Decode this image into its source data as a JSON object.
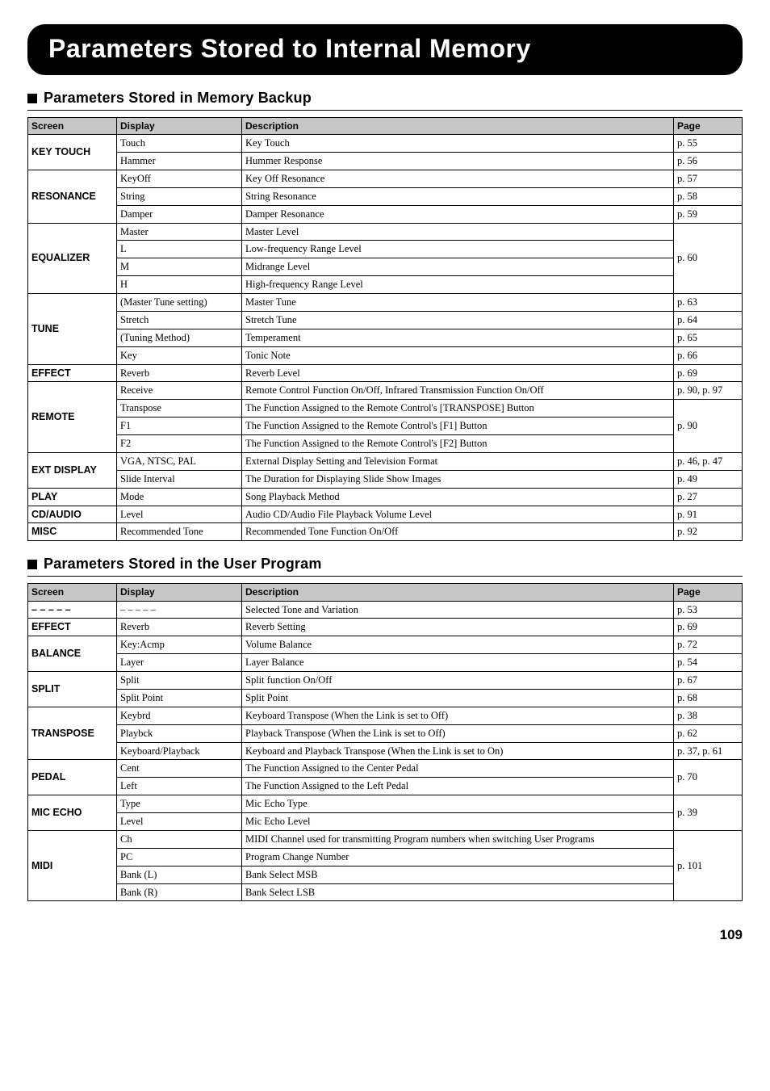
{
  "page_title": "Parameters Stored to Internal Memory",
  "page_number": "109",
  "sections": [
    {
      "title": "Parameters Stored in Memory Backup",
      "headers": {
        "screen": "Screen",
        "display": "Display",
        "description": "Description",
        "page": "Page"
      },
      "groups": [
        {
          "screen": "KEY TOUCH",
          "rows": [
            {
              "display": "Touch",
              "description": "Key Touch",
              "page": "p. 55"
            },
            {
              "display": "Hammer",
              "description": "Hummer Response",
              "page": "p. 56"
            }
          ]
        },
        {
          "screen": "RESONANCE",
          "rows": [
            {
              "display": "KeyOff",
              "description": "Key Off Resonance",
              "page": "p. 57"
            },
            {
              "display": "String",
              "description": "String Resonance",
              "page": "p. 58"
            },
            {
              "display": "Damper",
              "description": "Damper Resonance",
              "page": "p. 59"
            }
          ]
        },
        {
          "screen": "EQUALIZER",
          "page_shared": "p. 60",
          "rows": [
            {
              "display": "Master",
              "description": "Master Level"
            },
            {
              "display": "L",
              "description": "Low-frequency Range Level"
            },
            {
              "display": "M",
              "description": "Midrange Level"
            },
            {
              "display": "H",
              "description": "High-frequency Range Level"
            }
          ]
        },
        {
          "screen": "TUNE",
          "rows": [
            {
              "display": "(Master Tune setting)",
              "description": "Master Tune",
              "page": "p. 63"
            },
            {
              "display": "Stretch",
              "description": "Stretch Tune",
              "page": "p. 64"
            },
            {
              "display": "(Tuning Method)",
              "description": "Temperament",
              "page": "p. 65"
            },
            {
              "display": "Key",
              "description": "Tonic Note",
              "page": "p. 66"
            }
          ]
        },
        {
          "screen": "EFFECT",
          "rows": [
            {
              "display": "Reverb",
              "description": "Reverb Level",
              "page": "p. 69"
            }
          ]
        },
        {
          "screen": "REMOTE",
          "rows": [
            {
              "display": "Receive",
              "description": "Remote Control Function On/Off,\nInfrared Transmission Function On/Off",
              "page": "p. 90, p. 97"
            },
            {
              "display": "Transpose",
              "description": "The Function Assigned to the Remote Control's [TRANSPOSE] Button",
              "page_shared_start": true,
              "page_shared_value": "p. 90",
              "page_shared_span": 3
            },
            {
              "display": "F1",
              "description": "The Function Assigned to the Remote Control's [F1] Button"
            },
            {
              "display": "F2",
              "description": "The Function Assigned to the Remote Control's [F2] Button"
            }
          ]
        },
        {
          "screen": "EXT DISPLAY",
          "rows": [
            {
              "display": "VGA, NTSC, PAL",
              "description": "External Display Setting and Television Format",
              "page": "p. 46, p. 47"
            },
            {
              "display": "Slide Interval",
              "description": "The Duration for Displaying Slide Show Images",
              "page": "p. 49"
            }
          ]
        },
        {
          "screen": "PLAY",
          "rows": [
            {
              "display": "Mode",
              "description": "Song Playback Method",
              "page": "p. 27"
            }
          ]
        },
        {
          "screen": "CD/AUDIO",
          "rows": [
            {
              "display": "Level",
              "description": "Audio CD/Audio File Playback Volume Level",
              "page": "p. 91"
            }
          ]
        },
        {
          "screen": "MISC",
          "rows": [
            {
              "display": "Recommended Tone",
              "description": "Recommended Tone Function On/Off",
              "page": "p. 92"
            }
          ]
        }
      ]
    },
    {
      "title": "Parameters Stored in the User Program",
      "headers": {
        "screen": "Screen",
        "display": "Display",
        "description": "Description",
        "page": "Page"
      },
      "groups": [
        {
          "screen": "– – – – –",
          "rows": [
            {
              "display": "– – – – –",
              "description": "Selected Tone and Variation",
              "page": "p. 53"
            }
          ]
        },
        {
          "screen": "EFFECT",
          "rows": [
            {
              "display": "Reverb",
              "description": "Reverb Setting",
              "page": "p. 69"
            }
          ]
        },
        {
          "screen": "BALANCE",
          "rows": [
            {
              "display": "Key:Acmp",
              "description": "Volume Balance",
              "page": "p. 72"
            },
            {
              "display": "Layer",
              "description": "Layer Balance",
              "page": "p. 54"
            }
          ]
        },
        {
          "screen": "SPLIT",
          "rows": [
            {
              "display": "Split",
              "description": "Split function On/Off",
              "page": "p. 67"
            },
            {
              "display": "Split Point",
              "description": "Split Point",
              "page": "p. 68"
            }
          ]
        },
        {
          "screen": "TRANSPOSE",
          "rows": [
            {
              "display": "Keybrd",
              "description": "Keyboard Transpose (When the Link is set to Off)",
              "page": "p. 38"
            },
            {
              "display": "Playbck",
              "description": "Playback Transpose (When the Link is set to Off)",
              "page": "p. 62"
            },
            {
              "display": "Keyboard/Playback",
              "description": "Keyboard and Playback Transpose\n(When the Link is set to On)",
              "page": "p. 37, p. 61"
            }
          ]
        },
        {
          "screen": "PEDAL",
          "page_shared": "p. 70",
          "rows": [
            {
              "display": "Cent",
              "description": "The Function Assigned to the Center Pedal"
            },
            {
              "display": "Left",
              "description": "The Function Assigned to the Left Pedal"
            }
          ]
        },
        {
          "screen": "MIC ECHO",
          "page_shared": "p. 39",
          "rows": [
            {
              "display": "Type",
              "description": "Mic Echo Type"
            },
            {
              "display": "Level",
              "description": "Mic Echo Level"
            }
          ]
        },
        {
          "screen": "MIDI",
          "page_shared": "p. 101",
          "rows": [
            {
              "display": "Ch",
              "description": "MIDI Channel used for transmitting Program numbers when switching User Programs"
            },
            {
              "display": "PC",
              "description": "Program Change Number"
            },
            {
              "display": "Bank (L)",
              "description": "Bank Select MSB"
            },
            {
              "display": "Bank (R)",
              "description": "Bank Select LSB"
            }
          ]
        }
      ]
    }
  ]
}
